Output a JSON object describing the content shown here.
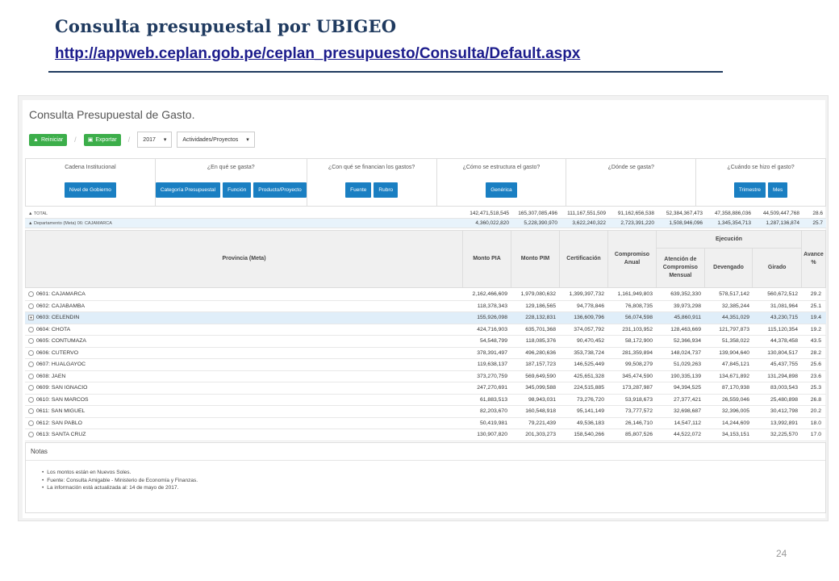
{
  "slide": {
    "title": "Consulta presupuestal por UBIGEO",
    "link": "http://appweb.ceplan.gob.pe/ceplan_presupuesto/Consulta/Default.aspx",
    "page_number": "24"
  },
  "app": {
    "heading": "Consulta Presupuestal de Gasto.",
    "toolbar": {
      "reiniciar": "Reiniciar",
      "exportar": "Exportar",
      "year": "2017",
      "mode": "Actividades/Proyectos"
    },
    "filters": [
      {
        "label": "Cadena Institucional",
        "buttons": [
          "Nivel de Gobierno"
        ]
      },
      {
        "label": "¿En qué se gasta?",
        "buttons": [
          "Categoría Presupuestal",
          "Función",
          "Producto/Proyecto"
        ]
      },
      {
        "label": "¿Con qué se financian los gastos?",
        "buttons": [
          "Fuente",
          "Rubro"
        ]
      },
      {
        "label": "¿Cómo se estructura el gasto?",
        "buttons": [
          "Genérica"
        ]
      },
      {
        "label": "¿Dónde se gasta?",
        "buttons": []
      },
      {
        "label": "¿Cuándo se hizo el gasto?",
        "buttons": [
          "Trimestre",
          "Mes"
        ]
      }
    ],
    "summary": [
      {
        "label": "TOTAL",
        "values": [
          "142,471,518,545",
          "165,307,085,496",
          "111,167,551,509",
          "91,162,656,538",
          "52,384,367,473",
          "47,358,886,036",
          "44,509,447,768",
          "28.6"
        ]
      },
      {
        "label": "Departamento (Meta) 06: CAJAMARCA",
        "values": [
          "4,360,022,820",
          "5,228,390,970",
          "3,622,240,322",
          "2,723,391,220",
          "1,508,946,096",
          "1,345,354,713",
          "1,287,136,874",
          "25.7"
        ]
      }
    ],
    "table": {
      "headers": {
        "provincia": "Provincia (Meta)",
        "pia": "Monto PIA",
        "pim": "Monto PIM",
        "cert": "Certificación",
        "comp": "Compromiso Anual",
        "ejecucion": "Ejecución",
        "atencion": "Atención de Compromiso Mensual",
        "devengado": "Devengado",
        "girado": "Girado",
        "avance": "Avance %"
      },
      "rows": [
        {
          "name": "0601: CAJAMARCA",
          "v": [
            "2,162,466,609",
            "1,979,080,632",
            "1,399,397,732",
            "1,161,949,803",
            "639,352,330",
            "578,517,142",
            "560,672,512",
            "29.2"
          ]
        },
        {
          "name": "0602: CAJABAMBA",
          "v": [
            "118,378,343",
            "129,186,565",
            "94,778,846",
            "76,808,735",
            "39,973,298",
            "32,385,244",
            "31,081,964",
            "25.1"
          ]
        },
        {
          "name": "0603: CELENDIN",
          "v": [
            "155,926,098",
            "228,132,831",
            "136,609,796",
            "56,074,598",
            "45,860,911",
            "44,351,029",
            "43,230,715",
            "19.4"
          ],
          "selected": true
        },
        {
          "name": "0604: CHOTA",
          "v": [
            "424,716,903",
            "635,701,368",
            "374,057,792",
            "231,103,952",
            "128,463,669",
            "121,797,873",
            "115,120,354",
            "19.2"
          ]
        },
        {
          "name": "0605: CONTUMAZA",
          "v": [
            "54,548,799",
            "118,085,376",
            "90,470,452",
            "58,172,900",
            "52,366,934",
            "51,358,022",
            "44,378,458",
            "43.5"
          ]
        },
        {
          "name": "0606: CUTERVO",
          "v": [
            "378,391,497",
            "496,280,636",
            "353,738,724",
            "281,359,894",
            "148,024,737",
            "139,904,640",
            "130,804,517",
            "28.2"
          ]
        },
        {
          "name": "0607: HUALGAYOC",
          "v": [
            "119,638,137",
            "187,157,723",
            "146,525,449",
            "99,508,279",
            "51,029,263",
            "47,845,121",
            "45,437,755",
            "25.6"
          ]
        },
        {
          "name": "0608: JAEN",
          "v": [
            "373,270,759",
            "569,649,590",
            "425,651,328",
            "345,474,590",
            "190,335,139",
            "134,671,892",
            "131,294,898",
            "23.6"
          ]
        },
        {
          "name": "0609: SAN IGNACIO",
          "v": [
            "247,270,691",
            "345,099,588",
            "224,515,885",
            "173,287,987",
            "94,394,525",
            "87,170,938",
            "83,003,543",
            "25.3"
          ]
        },
        {
          "name": "0610: SAN MARCOS",
          "v": [
            "61,883,513",
            "98,943,031",
            "73,276,720",
            "53,918,673",
            "27,377,421",
            "26,559,046",
            "25,480,898",
            "26.8"
          ]
        },
        {
          "name": "0611: SAN MIGUEL",
          "v": [
            "82,203,670",
            "160,548,918",
            "95,141,149",
            "73,777,572",
            "32,698,687",
            "32,396,005",
            "30,412,798",
            "20.2"
          ]
        },
        {
          "name": "0612: SAN PABLO",
          "v": [
            "50,419,981",
            "79,221,439",
            "49,536,183",
            "26,146,710",
            "14,547,112",
            "14,244,609",
            "13,992,891",
            "18.0"
          ]
        },
        {
          "name": "0613: SANTA CRUZ",
          "v": [
            "130,907,820",
            "201,303,273",
            "158,540,266",
            "85,807,526",
            "44,522,072",
            "34,153,151",
            "32,225,570",
            "17.0"
          ]
        }
      ]
    },
    "notes": {
      "title": "Notas",
      "items": [
        "Los montos están en Nuevos Soles.",
        "Fuente: Consulta Amigable - Ministerio de Economía y Finanzas.",
        "La información está actualizada al: 14 de mayo de 2017."
      ]
    }
  }
}
